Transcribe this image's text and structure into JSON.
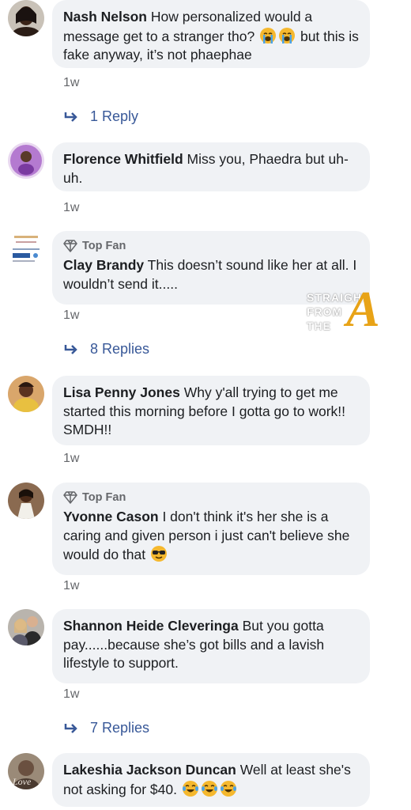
{
  "comments": [
    {
      "author": "Nash Nelson",
      "text": " How personalized would a message get to a stranger tho? ",
      "text_after": " but this is fake anyway, it’s not phaephae",
      "emojis": [
        "loudly-crying-face",
        "loudly-crying-face"
      ],
      "time": "1w",
      "replies": "1 Reply"
    },
    {
      "author": "Florence Whitfield",
      "text": " Miss you, Phaedra but uh-uh.",
      "time": "1w"
    },
    {
      "badge": "Top Fan",
      "author": "Clay Brandy",
      "text": " This doesn’t sound like her at all. I wouldn’t send it.....",
      "time": "1w",
      "replies": "8 Replies"
    },
    {
      "author": "Lisa Penny Jones",
      "text": " Why y'all trying to get me started this morning before I gotta go to work!! SMDH!!",
      "time": "1w"
    },
    {
      "badge": "Top Fan",
      "author": "Yvonne Cason",
      "text": " I don't think it's her she is a caring and given person i just can't believe she would do that ",
      "emojis": [
        "sunglasses-face"
      ],
      "time": "1w"
    },
    {
      "author": "Shannon Heide Cleveringa",
      "text": " But you gotta pay......because she’s got bills and a lavish lifestyle to support.",
      "time": "1w",
      "replies": "7 Replies"
    },
    {
      "author": "Lakeshia Jackson Duncan",
      "text": " Well at least she's not asking for $40. ",
      "emojis": [
        "tears-of-joy-face",
        "tears-of-joy-face",
        "tears-of-joy-face"
      ]
    }
  ],
  "watermark": {
    "line1": "STRAIGHT",
    "line2": "FROM",
    "line3": "THE",
    "logo_letter": "A"
  },
  "colors": {
    "bubble": "#f0f2f5",
    "link": "#385898",
    "meta": "#65676b",
    "watermark_gold": "#e8a317"
  }
}
